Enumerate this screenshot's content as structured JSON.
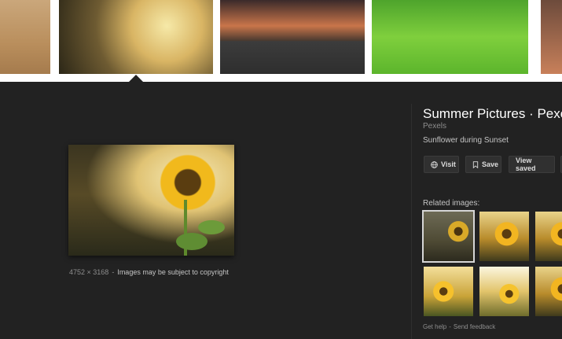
{
  "preview": {
    "dimensions": "4752 × 3168",
    "separator": "-",
    "copyright_note": "Images may be subject to copyright"
  },
  "details": {
    "title": "Summer Pictures · Pexels",
    "source": "Pexels",
    "caption": "Sunflower during Sunset",
    "buttons": {
      "visit": "Visit",
      "save": "Save",
      "view_saved": "View saved"
    },
    "related_label": "Related images:"
  },
  "footer": {
    "help": "Get help",
    "separator": "-",
    "feedback": "Send feedback"
  },
  "icons": {
    "visit": "globe-icon",
    "save": "bookmark-icon"
  },
  "colors": {
    "panel_background": "#222222",
    "strip_background": "#ffffff",
    "selected_outline": "#d6d6d6"
  }
}
